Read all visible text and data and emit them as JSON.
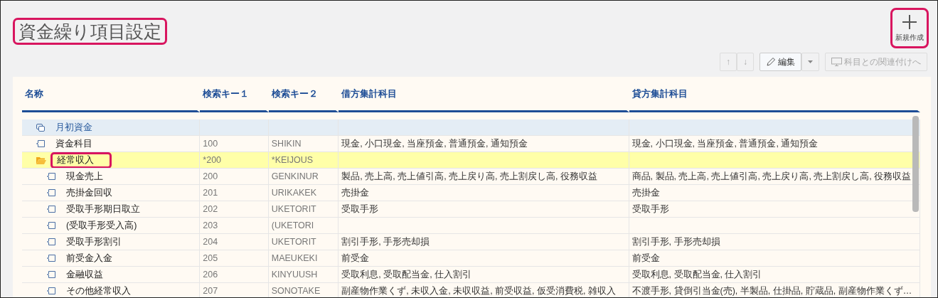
{
  "title": {
    "text": "資金繰り項目設定",
    "highlighted": true
  },
  "new_button": {
    "label": "新規作成",
    "highlighted": true
  },
  "toolbar": {
    "up": {
      "label": "↑",
      "disabled": true
    },
    "down": {
      "label": "↓",
      "disabled": true
    },
    "edit": {
      "label": "編集"
    },
    "link": {
      "label": "科目との関連付けへ",
      "disabled": true
    }
  },
  "table": {
    "columns": [
      "名称",
      "検索キー１",
      "検索キー２",
      "借方集計科目",
      "貸方集計科目"
    ],
    "rows": [
      {
        "kind": "group",
        "name": "月初資金",
        "selected": false,
        "highlighted": false
      },
      {
        "kind": "item",
        "name": "資金科目",
        "key1": "100",
        "key2": "SHIKIN",
        "debit": "現金, 小口現金, 当座預金, 普通預金, 通知預金",
        "credit": "現金, 小口現金, 当座預金, 普通預金, 通知預金",
        "selected": false,
        "highlighted": false
      },
      {
        "kind": "folder",
        "name": "経常収入",
        "key1": "*200",
        "key2": "*KEIJOUS",
        "selected": true,
        "highlighted": true,
        "children": [
          {
            "kind": "item",
            "name": "現金売上",
            "key1": "200",
            "key2": "GENKINUR",
            "debit": "製品, 売上高, 売上値引高, 売上戻り高, 売上割戻し高, 役務収益",
            "credit": "商品, 製品, 売上高, 売上値引高, 売上戻り高, 売上割戻し高, 役務収益",
            "selected": false,
            "highlighted": false
          },
          {
            "kind": "item",
            "name": "売掛金回収",
            "key1": "201",
            "key2": "URIKAKEK",
            "debit": "売掛金",
            "credit": "売掛金",
            "selected": false,
            "highlighted": false
          },
          {
            "kind": "item",
            "name": "受取手形期日取立",
            "key1": "202",
            "key2": "UKETORIT",
            "debit": "受取手形",
            "credit": "受取手形",
            "selected": false,
            "highlighted": false
          },
          {
            "kind": "item",
            "name": "(受取手形受入高)",
            "key1": "203",
            "key2": "(UKETORI",
            "selected": false,
            "highlighted": false
          },
          {
            "kind": "item",
            "name": "受取手形割引",
            "key1": "204",
            "key2": "UKETORIT",
            "debit": "割引手形, 手形売却損",
            "credit": "割引手形, 手形売却損",
            "selected": false,
            "highlighted": false
          },
          {
            "kind": "item",
            "name": "前受金入金",
            "key1": "205",
            "key2": "MAEUKEKI",
            "debit": "前受金",
            "credit": "前受金",
            "selected": false,
            "highlighted": false
          },
          {
            "kind": "item",
            "name": "金融収益",
            "key1": "206",
            "key2": "KINYUUSH",
            "debit": "受取利息, 受取配当金, 仕入割引",
            "credit": "受取利息, 受取配当金, 仕入割引",
            "selected": false,
            "highlighted": false
          },
          {
            "kind": "item",
            "name": "その他経常収入",
            "key1": "207",
            "key2": "SONOTAKE",
            "debit": "副産物作業くず, 未収入金, 未収収益, 前受収益, 仮受消費税, 雑収入",
            "credit": "不渡手形, 貸倒引当金(売), 半製品, 仕掛品, 貯蔵品, 副産物作業くず…",
            "selected": false,
            "highlighted": false
          }
        ]
      }
    ]
  }
}
